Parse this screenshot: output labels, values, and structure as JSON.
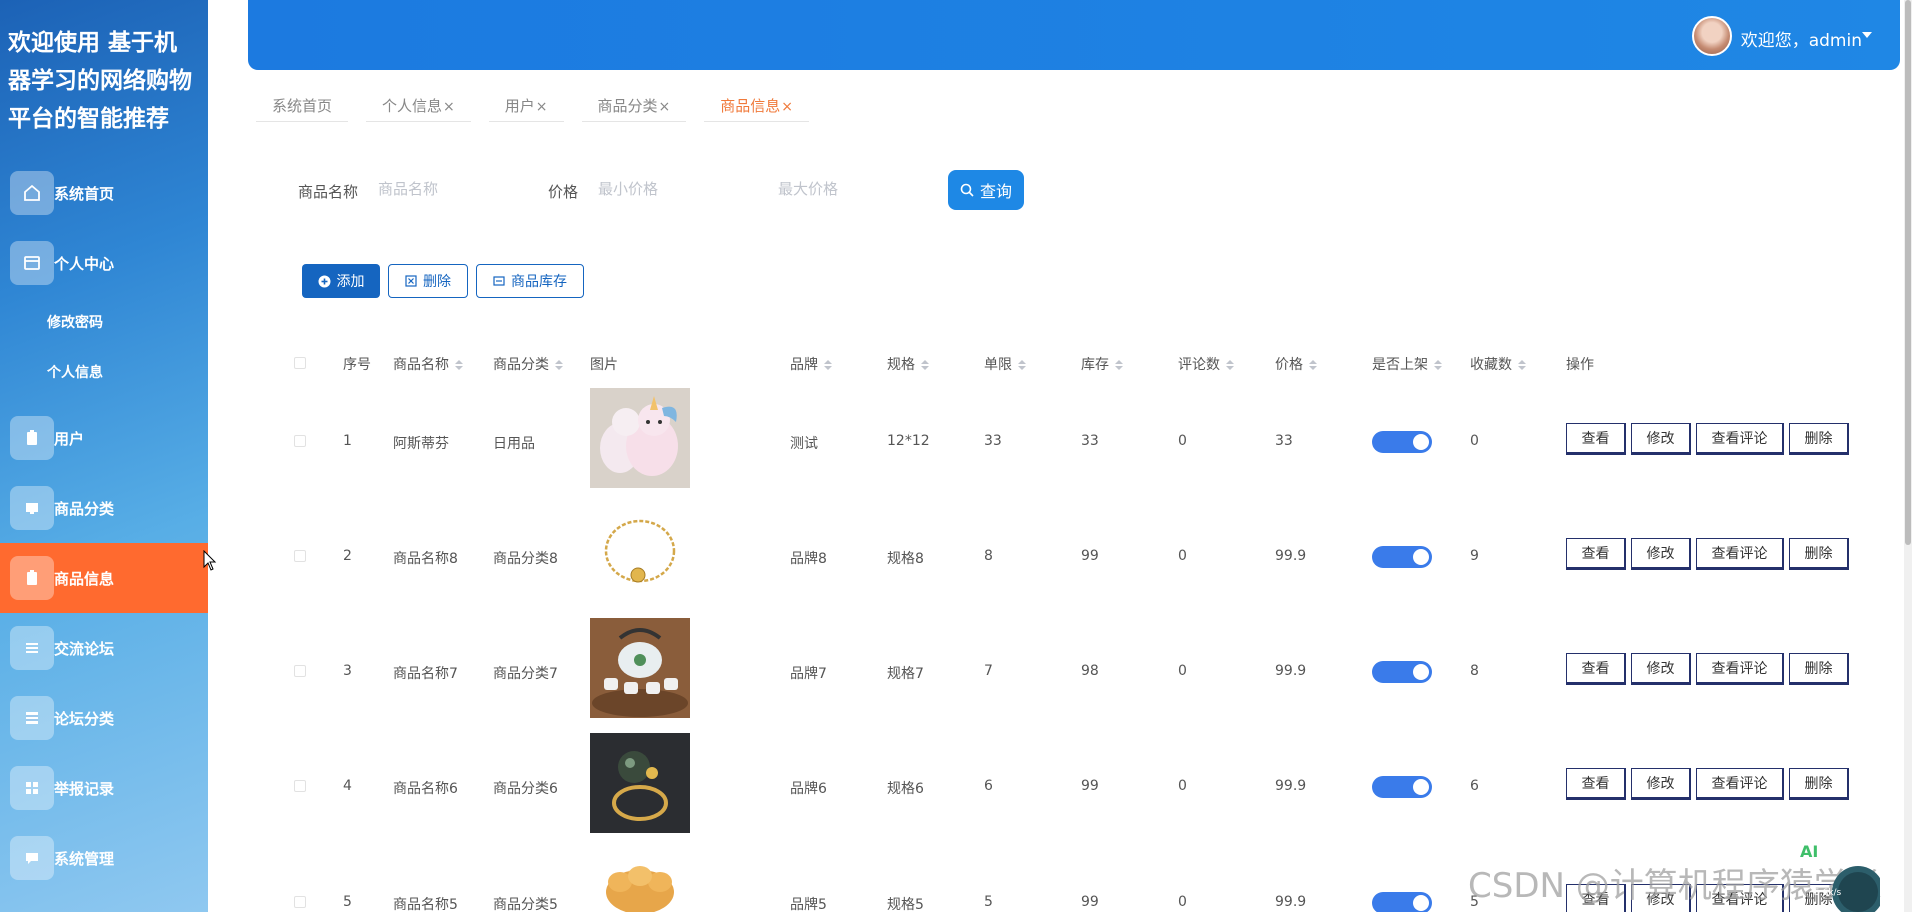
{
  "app": {
    "title": "欢迎使用 基于机器学习的网络购物平台的智能推荐"
  },
  "header": {
    "welcome": "欢迎您，admin"
  },
  "sidebar": {
    "items": [
      {
        "label": "系统首页",
        "icon": "home-icon"
      },
      {
        "label": "个人中心",
        "icon": "user-card-icon"
      },
      {
        "label": "修改密码",
        "sub": true
      },
      {
        "label": "个人信息",
        "sub": true
      },
      {
        "label": "用户",
        "icon": "clipboard-icon"
      },
      {
        "label": "商品分类",
        "icon": "monitor-icon"
      },
      {
        "label": "商品信息",
        "icon": "clipboard-icon",
        "active": true
      },
      {
        "label": "交流论坛",
        "icon": "list-icon"
      },
      {
        "label": "论坛分类",
        "icon": "table-icon"
      },
      {
        "label": "举报记录",
        "icon": "grid-icon"
      },
      {
        "label": "系统管理",
        "icon": "chat-icon"
      }
    ]
  },
  "tabs": [
    {
      "label": "系统首页",
      "closable": false
    },
    {
      "label": "个人信息",
      "closable": true
    },
    {
      "label": "用户",
      "closable": true
    },
    {
      "label": "商品分类",
      "closable": true
    },
    {
      "label": "商品信息",
      "closable": true,
      "active": true
    }
  ],
  "tab_close": "×",
  "search": {
    "name_label": "商品名称",
    "name_placeholder": "商品名称",
    "price_label": "价格",
    "min_placeholder": "最小价格",
    "max_placeholder": "最大价格",
    "query_label": "查询"
  },
  "actions": {
    "add": "添加",
    "delete": "删除",
    "stock": "商品库存"
  },
  "table": {
    "headers": {
      "index": "序号",
      "name": "商品名称",
      "category": "商品分类",
      "image": "图片",
      "brand": "品牌",
      "spec": "规格",
      "limit": "单限",
      "stock": "库存",
      "comments": "评论数",
      "price": "价格",
      "listed": "是否上架",
      "favorites": "收藏数",
      "ops": "操作"
    },
    "rows": [
      {
        "index": "1",
        "name": "阿斯蒂芬",
        "category": "日用品",
        "image": "unicorn-plush",
        "brand": "测试",
        "spec": "12*12",
        "limit": "33",
        "stock": "33",
        "comments": "0",
        "price": "33",
        "listed": true,
        "favorites": "0"
      },
      {
        "index": "2",
        "name": "商品名称8",
        "category": "商品分类8",
        "image": "gold-bracelet",
        "brand": "品牌8",
        "spec": "规格8",
        "limit": "8",
        "stock": "99",
        "comments": "0",
        "price": "99.9",
        "listed": true,
        "favorites": "9"
      },
      {
        "index": "3",
        "name": "商品名称7",
        "category": "商品分类7",
        "image": "tea-set",
        "brand": "品牌7",
        "spec": "规格7",
        "limit": "7",
        "stock": "98",
        "comments": "0",
        "price": "99.9",
        "listed": true,
        "favorites": "8"
      },
      {
        "index": "4",
        "name": "商品名称6",
        "category": "商品分类6",
        "image": "pearl-ring",
        "brand": "品牌6",
        "spec": "规格6",
        "limit": "6",
        "stock": "99",
        "comments": "0",
        "price": "99.9",
        "listed": true,
        "favorites": "6"
      },
      {
        "index": "5",
        "name": "商品名称5",
        "category": "商品分类5",
        "image": "flower-ornament",
        "brand": "品牌5",
        "spec": "规格5",
        "limit": "5",
        "stock": "99",
        "comments": "0",
        "price": "99.9",
        "listed": true,
        "favorites": "5"
      }
    ],
    "op_labels": {
      "view": "查看",
      "edit": "修改",
      "view_comments": "查看评论",
      "delete": "删除"
    }
  },
  "watermark": "CSDN @计算机程序猿学长",
  "badge": {
    "ai": "AI",
    "speed": "5.6k/s"
  },
  "colors": {
    "primary": "#1e88e5",
    "active_menu": "#ff6a2f",
    "active_tab": "#f07a3b",
    "toggle_on": "#3a7bea"
  }
}
